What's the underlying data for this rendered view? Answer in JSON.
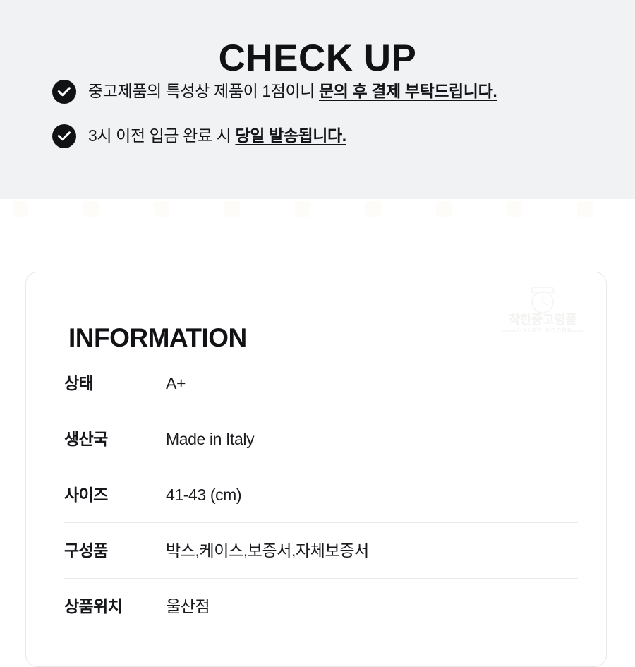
{
  "checkup": {
    "title": "CHECK UP",
    "items": [
      {
        "icon": "check-circle-icon",
        "text_plain": "중고제품의 특성상 제품이 1점이니 ",
        "text_emphasis": "문의 후 결제 부탁드립니다."
      },
      {
        "icon": "check-circle-icon",
        "text_plain": "3시 이전 입금 완료 시 ",
        "text_emphasis": "당일 발송됩니다."
      }
    ]
  },
  "information": {
    "title": "INFORMATION",
    "watermark": {
      "brand": "착한중고명품",
      "subtitle": "LUXURY GOODS"
    },
    "rows": [
      {
        "label": "상태",
        "value": "A+"
      },
      {
        "label": "생산국",
        "value": "Made in Italy"
      },
      {
        "label": "사이즈",
        "value": "41-43 (cm)"
      },
      {
        "label": "구성품",
        "value": "박스,케이스,보증서,자체보증서"
      },
      {
        "label": "상품위치",
        "value": "울산점"
      }
    ]
  },
  "colors": {
    "panel_background": "#f1f2f4",
    "page_background": "#ffffff",
    "text_primary": "#111214",
    "icon_fill": "#111214",
    "icon_glyph": "#ffffff",
    "card_border": "#e7e8ea",
    "row_divider": "#eaebec",
    "watermark": "#f3f3f2"
  }
}
